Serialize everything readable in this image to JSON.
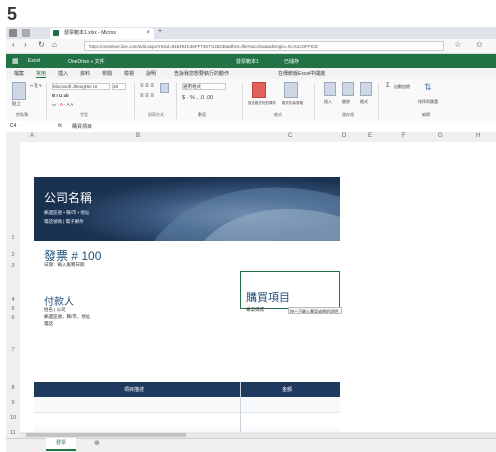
{
  "step_number": "5",
  "browser": {
    "tab_title": "發票範本1.xlsx - Micros",
    "tab_close": "×",
    "new_tab": "+",
    "url": "https://onedrive.live.com/edit.aspx?resid=845494C46FF7207!145238&ithint=file%2cxlsx&wdOrigin=XL%2cOFFICE",
    "back": "‹",
    "forward": "›",
    "refresh": "↻",
    "home": "⌂"
  },
  "excel_bar": {
    "app": "Excel",
    "path": "OneDrive » 文件",
    "file": "發票範本1",
    "status": "已儲存"
  },
  "ribbon_tabs": [
    "檔案",
    "常用",
    "插入",
    "資料",
    "校閱",
    "檢視",
    "說明",
    "告訴我您想要執行的動作",
    "在傳統版Excel中開啟"
  ],
  "ribbon": {
    "paste": "貼上",
    "font_name": "Microsoft JhengHei UI",
    "font_size": "28",
    "clipboard": "剪貼簿",
    "font": "字型",
    "alignment": "對齊方式",
    "number_format": "通用格式",
    "number": "數值",
    "styles": "樣式",
    "cond_format": "設定格式化的條件",
    "table_format": "格式化為表格",
    "cells": "儲存格",
    "insert": "插入",
    "delete": "刪除",
    "format": "格式",
    "autosum": "自動加總",
    "sort_filter": "排序與篩選",
    "editing": "編輯"
  },
  "formula_bar": {
    "cell_ref": "C4",
    "fx": "fx",
    "content": "購買項目"
  },
  "columns": [
    "A",
    "B",
    "C",
    "D",
    "E",
    "F",
    "G",
    "H"
  ],
  "rows": [
    "1",
    "2",
    "3",
    "4",
    "5",
    "6",
    "7",
    "8",
    "9",
    "10",
    "11"
  ],
  "invoice": {
    "company": "公司名稱",
    "company_line1": "郵遞區號 • 縣/市 • 地址",
    "company_line2": "電話號碼 | 電子郵件",
    "invoice_no": "發票 # 100",
    "invoice_date": "日期：輸入服務日期",
    "payer": "付款人",
    "payer_line1": "姓名 | 公司",
    "payer_line2": "郵遞區號，縣/市，地址",
    "payer_line3": "電話",
    "buyer": "購買項目",
    "buyer_label": "專案或標",
    "tooltip": "按一下輸入專案或標的說明",
    "col_desc": "項目描述",
    "col_amount": "金額"
  },
  "sheet_tab": "發票"
}
